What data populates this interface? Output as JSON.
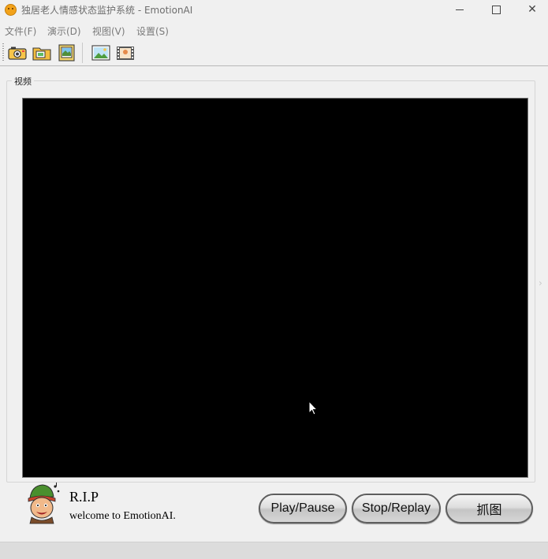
{
  "window": {
    "title": "独居老人情感状态监护系统 - EmotionAI"
  },
  "menu": [
    {
      "label": "文件(F)"
    },
    {
      "label": "演示(D)"
    },
    {
      "label": "视图(V)"
    },
    {
      "label": "设置(S)"
    }
  ],
  "toolbar": {
    "icons": [
      "camera-icon",
      "video-file-icon",
      "photo-album-icon",
      "image-icon",
      "film-strip-icon"
    ]
  },
  "video_group": {
    "title": "视频"
  },
  "footer": {
    "rip_text": "R.I.P",
    "welcome_text": "welcome to EmotionAI."
  },
  "buttons": {
    "play_pause": "Play/Pause",
    "stop_replay": "Stop/Replay",
    "capture": "抓图"
  },
  "colors": {
    "video_background": "#000000",
    "window_background": "#f0f0f0",
    "app_icon": "#f2a21a"
  }
}
